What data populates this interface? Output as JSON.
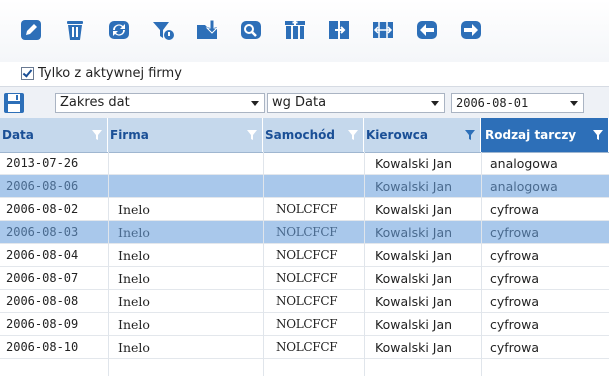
{
  "toolbar": {
    "buttons": [
      {
        "icon": "pencil-icon",
        "name": "edit-button"
      },
      {
        "icon": "trash-icon",
        "name": "delete-button"
      },
      {
        "icon": "refresh-icon",
        "name": "refresh-button"
      },
      {
        "icon": "filter-clear-icon",
        "name": "filter-button"
      },
      {
        "icon": "folder-download-icon",
        "name": "import-button"
      },
      {
        "icon": "search-icon",
        "name": "search-button"
      },
      {
        "icon": "columns-icon",
        "name": "columns-button"
      },
      {
        "icon": "export-icon",
        "name": "export-button"
      },
      {
        "icon": "fit-width-icon",
        "name": "fit-width-button"
      },
      {
        "icon": "arrow-left-icon",
        "name": "back-button"
      },
      {
        "icon": "arrow-right-icon",
        "name": "forward-button"
      }
    ],
    "accent": "#2d6fb8"
  },
  "options": {
    "active_company_label": "Tylko z aktywnej firmy",
    "active_company_checked": true
  },
  "filters": {
    "range_value": "Zakres dat",
    "by_value": "wg Data",
    "date_value": "2006-08-01"
  },
  "grid": {
    "columns": [
      "Data",
      "Firma",
      "Samochód",
      "Kierowca",
      "Rodzaj tarczy"
    ],
    "sorted_column": "Rodzaj tarczy",
    "rows": [
      {
        "data": "2013-07-26",
        "firma": "",
        "samochod": "",
        "kierowca": "Kowalski Jan",
        "rodzaj": "analogowa",
        "selected": false
      },
      {
        "data": "2006-08-06",
        "firma": "",
        "samochod": "",
        "kierowca": "Kowalski Jan",
        "rodzaj": "analogowa",
        "selected": true
      },
      {
        "data": "2006-08-02",
        "firma": "Inelo",
        "samochod": "NOLCFCF",
        "kierowca": "Kowalski Jan",
        "rodzaj": "cyfrowa",
        "selected": false
      },
      {
        "data": "2006-08-03",
        "firma": "Inelo",
        "samochod": "NOLCFCF",
        "kierowca": "Kowalski Jan",
        "rodzaj": "cyfrowa",
        "selected": true
      },
      {
        "data": "2006-08-04",
        "firma": "Inelo",
        "samochod": "NOLCFCF",
        "kierowca": "Kowalski Jan",
        "rodzaj": "cyfrowa",
        "selected": false
      },
      {
        "data": "2006-08-07",
        "firma": "Inelo",
        "samochod": "NOLCFCF",
        "kierowca": "Kowalski Jan",
        "rodzaj": "cyfrowa",
        "selected": false
      },
      {
        "data": "2006-08-08",
        "firma": "Inelo",
        "samochod": "NOLCFCF",
        "kierowca": "Kowalski Jan",
        "rodzaj": "cyfrowa",
        "selected": false
      },
      {
        "data": "2006-08-09",
        "firma": "Inelo",
        "samochod": "NOLCFCF",
        "kierowca": "Kowalski Jan",
        "rodzaj": "cyfrowa",
        "selected": false
      },
      {
        "data": "2006-08-10",
        "firma": "Inelo",
        "samochod": "NOLCFCF",
        "kierowca": "Kowalski Jan",
        "rodzaj": "cyfrowa",
        "selected": false
      }
    ]
  }
}
